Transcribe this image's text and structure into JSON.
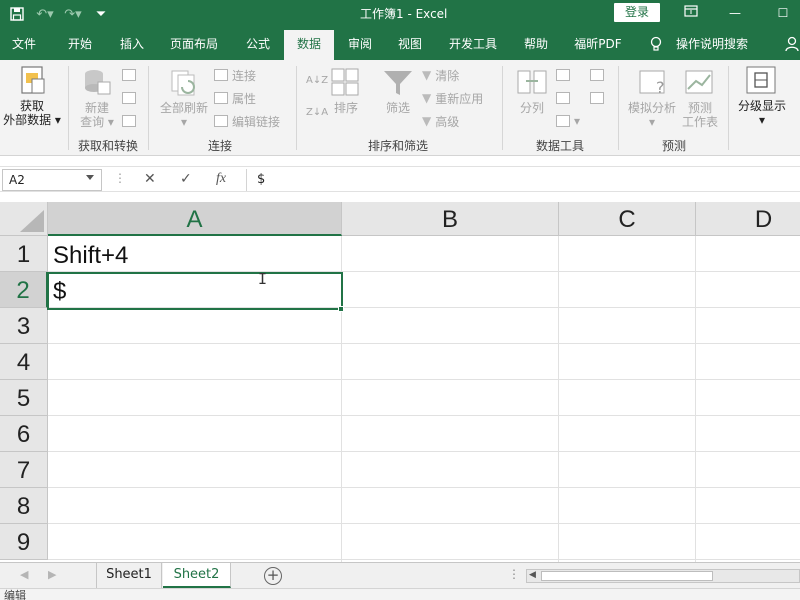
{
  "titlebar": {
    "title": "工作簿1  -  Excel",
    "login_label": "登录",
    "qat_icons": [
      "save-icon",
      "undo-icon",
      "redo-icon",
      "customize-icon"
    ],
    "win_icons": [
      "ribbon-display-icon",
      "minimize-icon",
      "restore-icon"
    ],
    "accent": "#217346"
  },
  "tabs": [
    "文件",
    "开始",
    "插入",
    "页面布局",
    "公式",
    "数据",
    "审阅",
    "视图",
    "开发工具",
    "帮助",
    "福昕PDF",
    "操作说明搜索"
  ],
  "active_tab": "数据",
  "ribbon": {
    "get_data": {
      "line1": "获取",
      "line2": "外部数据"
    },
    "new_query": {
      "line1": "新建",
      "line2": "查询"
    },
    "group_get_transform": "获取和转换",
    "refresh_all": "全部刷新",
    "connections": "连接",
    "properties": "属性",
    "edit_links": "编辑链接",
    "group_connections": "连接",
    "sort_az": "A↓Z",
    "sort_za": "Z↓A",
    "sort": "排序",
    "filter": "筛选",
    "clear": "清除",
    "reapply": "重新应用",
    "advanced": "高级",
    "group_sort_filter": "排序和筛选",
    "text_to_columns": "分列",
    "group_data_tools": "数据工具",
    "what_if": "模拟分析",
    "forecast_sheet": {
      "line1": "预测",
      "line2": "工作表"
    },
    "group_forecast": "预测",
    "outline": "分级显示"
  },
  "formula_bar": {
    "name_box": "A2",
    "cancel_icon": "✕",
    "enter_icon": "✓",
    "fx_label": "fx",
    "value": "$"
  },
  "grid": {
    "columns": [
      "A",
      "B",
      "C",
      "D"
    ],
    "rows": [
      "1",
      "2",
      "3",
      "4",
      "5",
      "6",
      "7",
      "8",
      "9"
    ],
    "cells": {
      "A1": "Shift+4",
      "A2": "$"
    },
    "active_cell": "A2"
  },
  "sheets": [
    "Sheet1",
    "Sheet2"
  ],
  "active_sheet": "Sheet2",
  "status": {
    "mode": "编辑"
  }
}
